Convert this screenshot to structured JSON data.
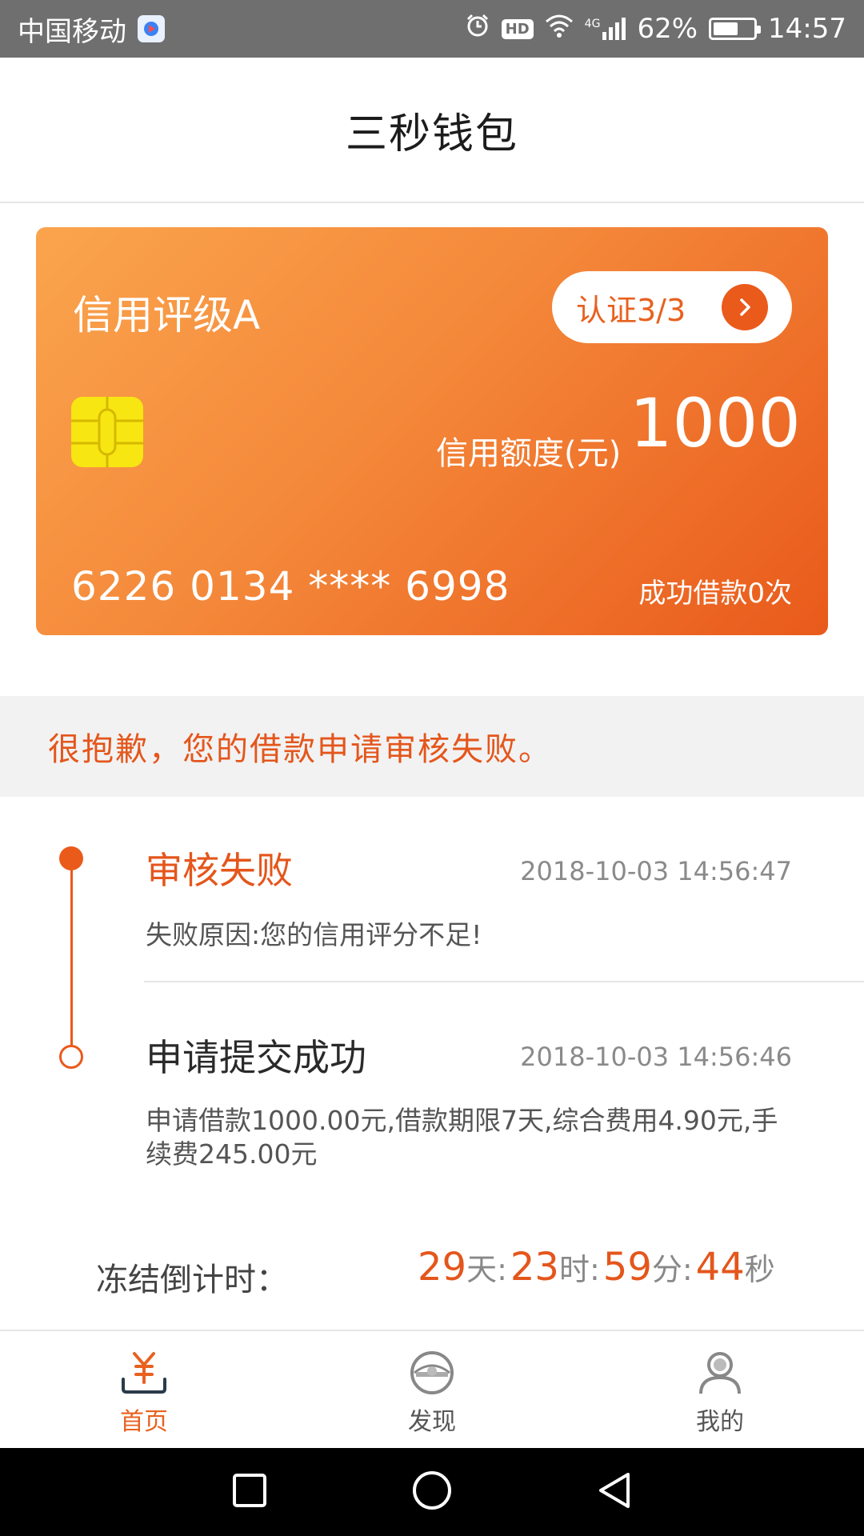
{
  "status_bar": {
    "carrier": "中国移动",
    "hd": "HD",
    "network": "4G",
    "battery": "62%",
    "battery_level": 0.62,
    "time": "14:57"
  },
  "header": {
    "title": "三秒钱包"
  },
  "card": {
    "rating": "信用评级A",
    "certification": "认证3/3",
    "limit_label": "信用额度(元)",
    "limit_value": "1000",
    "card_number": "6226 0134 **** 6998",
    "loan_count": "成功借款0次"
  },
  "notice": {
    "text": "很抱歉，您的借款申请审核失败。"
  },
  "timeline": [
    {
      "title": "审核失败",
      "time": "2018-10-03 14:56:47",
      "desc": "失败原因:您的信用评分不足!"
    },
    {
      "title": "申请提交成功",
      "time": "2018-10-03 14:56:46",
      "desc": "申请借款1000.00元,借款期限7天,综合费用4.90元,手续费245.00元"
    }
  ],
  "countdown": {
    "label": "冻结倒计时：",
    "days": "29",
    "days_unit": "天:",
    "hours": "23",
    "hours_unit": "时:",
    "minutes": "59",
    "minutes_unit": "分:",
    "seconds": "44",
    "seconds_unit": "秒"
  },
  "bottom_nav": {
    "items": [
      {
        "label": "首页",
        "icon": "yuan-tray-icon",
        "active": true
      },
      {
        "label": "发现",
        "icon": "eye-icon",
        "active": false
      },
      {
        "label": "我的",
        "icon": "person-icon",
        "active": false
      }
    ]
  },
  "colors": {
    "accent": "#ea5a1b",
    "card_start": "#faa44d",
    "card_end": "#e95a1b",
    "chip": "#f7e611"
  }
}
